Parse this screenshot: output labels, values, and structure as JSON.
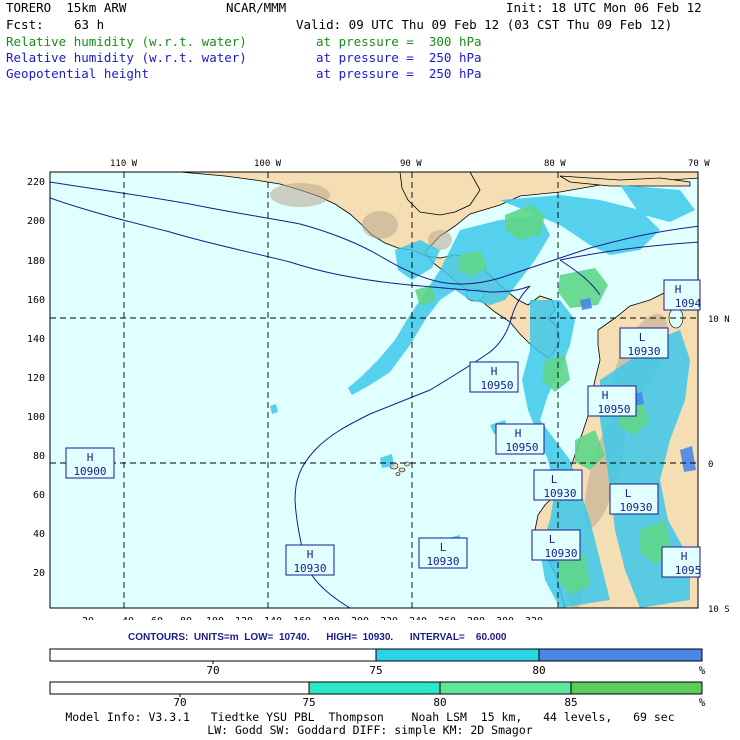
{
  "header": {
    "model": "TORERO  15km ARW",
    "center": "NCAR/MMM",
    "init": "Init: 18 UTC Mon 06 Feb 12",
    "fcst_label": "Fcst:",
    "fcst_value": "63 h",
    "valid": "Valid: 09 UTC Thu 09 Feb 12 (03 CST Thu 09 Feb 12)",
    "fields": [
      {
        "name": "Relative humidity (w.r.t. water)",
        "level": "at pressure =  300 hPa",
        "color": "#1a8c1a"
      },
      {
        "name": "Relative humidity (w.r.t. water)",
        "level": "at pressure =  250 hPa",
        "color": "#1a1acc"
      },
      {
        "name": "Geopotential height",
        "level": "at pressure =  250 hPa",
        "color": "#1a1acc"
      }
    ]
  },
  "map": {
    "lon_labels": [
      "110 W",
      "100 W",
      "90 W",
      "80 W",
      "70 W"
    ],
    "lat_labels": [
      "10 N",
      "0",
      "10 S"
    ],
    "y_ticks": [
      "220",
      "200",
      "180",
      "160",
      "140",
      "120",
      "100",
      "80",
      "60",
      "40",
      "20"
    ],
    "x_ticks": [
      "20",
      "40",
      "60",
      "80",
      "100",
      "120",
      "140",
      "160",
      "180",
      "200",
      "220",
      "240",
      "260",
      "280",
      "300",
      "320"
    ],
    "ocean_color": "#e0ffff",
    "land_color": "#f5deb3",
    "pressure_centers": [
      {
        "type": "H",
        "value": "10900"
      },
      {
        "type": "H",
        "value": "10930"
      },
      {
        "type": "L",
        "value": "10930"
      },
      {
        "type": "H",
        "value": "10950"
      },
      {
        "type": "H",
        "value": "10950"
      },
      {
        "type": "H",
        "value": "10950"
      },
      {
        "type": "L",
        "value": "10930"
      },
      {
        "type": "L",
        "value": "10930"
      },
      {
        "type": "L",
        "value": "10930"
      },
      {
        "type": "L",
        "value": "10930"
      },
      {
        "type": "H",
        "value": "1094"
      },
      {
        "type": "H",
        "value": "1095"
      }
    ]
  },
  "contours": {
    "text": "CONTOURS:  UNITS=m  LOW=  10740.      HIGH=  10930.      INTERVAL=    60.000"
  },
  "colorbars": [
    {
      "labels": [
        "70",
        "75",
        "80"
      ],
      "unit": "%",
      "colors": [
        "#ffffff",
        "#2ad4e6",
        "#4a86e8"
      ]
    },
    {
      "labels": [
        "70",
        "75",
        "80",
        "85"
      ],
      "unit": "%",
      "colors": [
        "#ffffff",
        "#2ee6c8",
        "#5ee6a0",
        "#5acd5a"
      ]
    }
  ],
  "model_info": {
    "line1": "Model Info: V3.3.1   Tiedtke YSU PBL  Thompson    Noah LSM  15 km,   44 levels,   69 sec",
    "line2": "LW: Godd SW: Goddard DIFF: simple KM: 2D Smagor"
  }
}
